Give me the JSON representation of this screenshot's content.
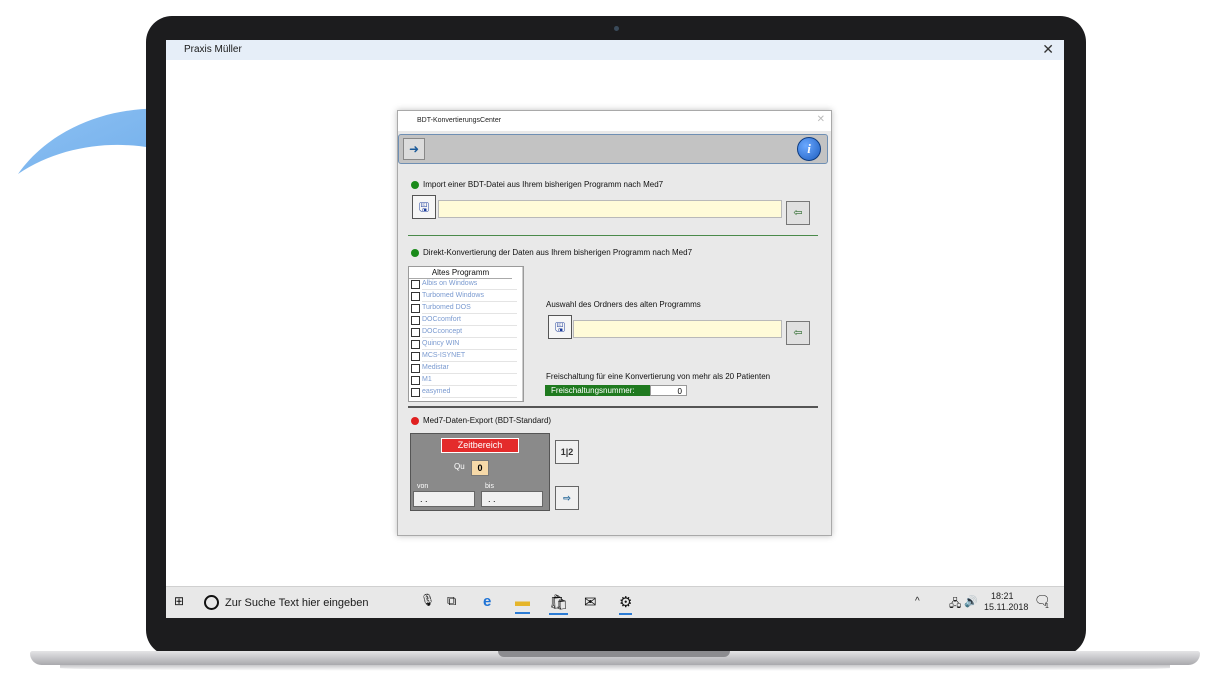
{
  "window": {
    "title": "Praxis Müller",
    "close_glyph": "✕"
  },
  "dialog": {
    "title": "BDT-KonvertierungsCenter",
    "close_glyph": "✕",
    "toolbar": {
      "exit_icon": "exit-door-icon",
      "info_label": "i"
    },
    "import_section": {
      "heading": "Import einer BDT-Datei aus Ihrem bisherigen Programm nach Med7",
      "dot_color": "#1a8a1a",
      "file_value": ""
    },
    "direct_section": {
      "heading": "Direkt-Konvertierung der Daten aus Ihrem bisherigen Programm nach Med7",
      "dot_color": "#1a8a1a",
      "list_header": "Altes Programm",
      "programs": [
        "Albis on Windows",
        "Turbomed Windows",
        "Turbomed DOS",
        "DOCcomfort",
        "DOCconcept",
        "Quincy WIN",
        "MCS-ISYNET",
        "Medistar",
        "M1",
        "easymed"
      ],
      "folder_label": "Auswahl des Ordners des alten Programms",
      "folder_value": "",
      "unlock_label": "Freischaltung für eine Konvertierung von mehr als 20 Patienten",
      "unlock_number_label": "Freischaltungsnummer:",
      "unlock_number_value": "0"
    },
    "export_section": {
      "heading": "Med7-Daten-Export (BDT-Standard)",
      "dot_color": "#e02020",
      "zeitbereich": "Zeitbereich",
      "qu_label": "Qu",
      "qu_value": "0",
      "von_label": "von",
      "bis_label": "bis",
      "von_value": ". .",
      "bis_value": ". ."
    }
  },
  "taskbar": {
    "search_placeholder": "Zur Suche Text hier eingeben",
    "time": "18:21",
    "date": "15.11.2018",
    "notification_count": "1",
    "tray_up": "^",
    "tray_volume": "🔊"
  }
}
